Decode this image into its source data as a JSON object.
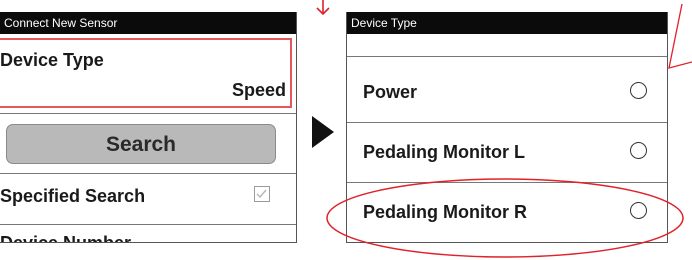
{
  "left_screen": {
    "title": "Connect New Sensor",
    "device_type_label": "Device Type",
    "device_type_value": "Speed",
    "search_label": "Search",
    "specified_search_label": "Specified Search",
    "device_number_label": "Device Number"
  },
  "right_screen": {
    "title": "Device Type",
    "options": [
      {
        "label": "Power"
      },
      {
        "label": "Pedaling Monitor L"
      },
      {
        "label": "Pedaling Monitor R"
      }
    ]
  },
  "colors": {
    "title_bar": "#0b0b0b",
    "highlight": "#e2585b",
    "annotation": "#e0222a",
    "button": "#b9b9b9"
  }
}
